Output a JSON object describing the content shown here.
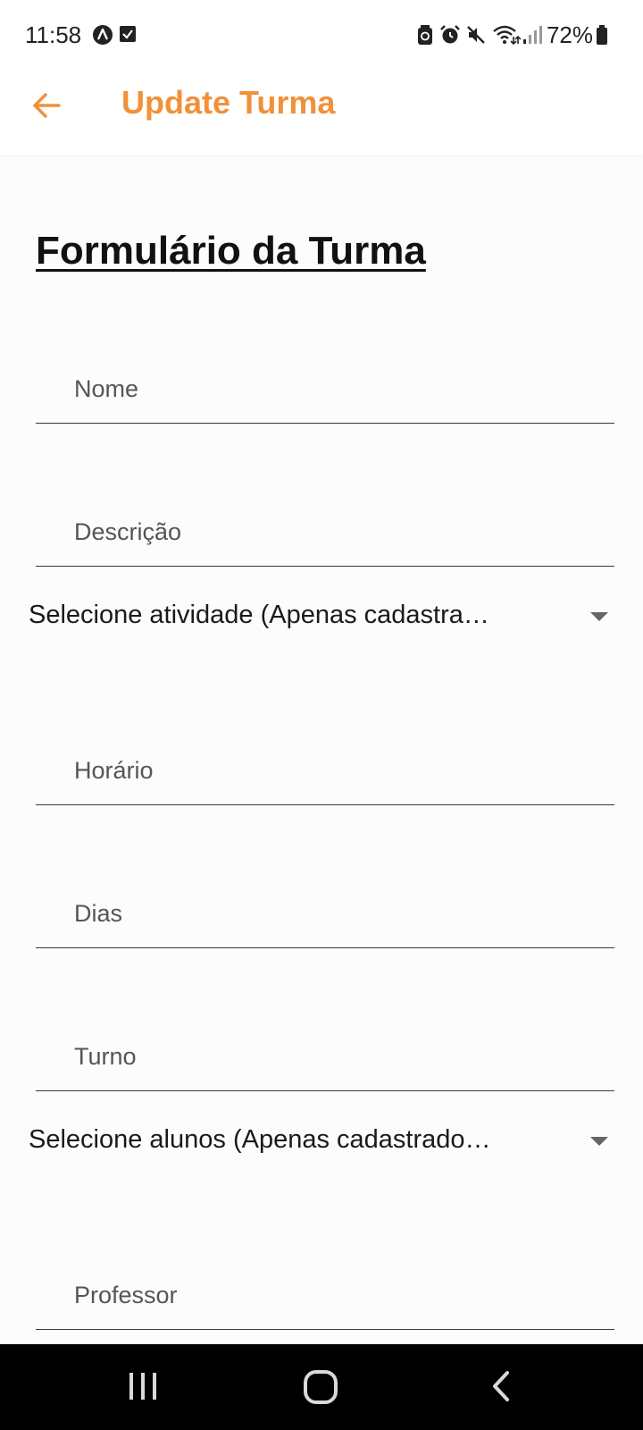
{
  "status_bar": {
    "time": "11:58",
    "battery": "72%",
    "left_icons": [
      "app-a-icon",
      "checkbox-icon"
    ],
    "right_icons": [
      "battery-saver-icon",
      "alarm-icon",
      "mute-icon",
      "wifi-icon",
      "signal-icon",
      "battery-icon"
    ]
  },
  "app_bar": {
    "title": "Update Turma",
    "accent_color": "#f0913a"
  },
  "form": {
    "title": "Formulário da Turma",
    "fields": {
      "nome": "Nome",
      "descricao": "Descrição",
      "horario": "Horário",
      "dias": "Dias",
      "turno": "Turno",
      "professor": "Professor"
    },
    "dropdowns": {
      "atividade": "Selecione atividade (Apenas cadastra…",
      "alunos": "Selecione alunos (Apenas cadastrado…"
    }
  },
  "nav_bar": {
    "buttons": [
      "recents-icon",
      "home-icon",
      "back-icon"
    ]
  }
}
